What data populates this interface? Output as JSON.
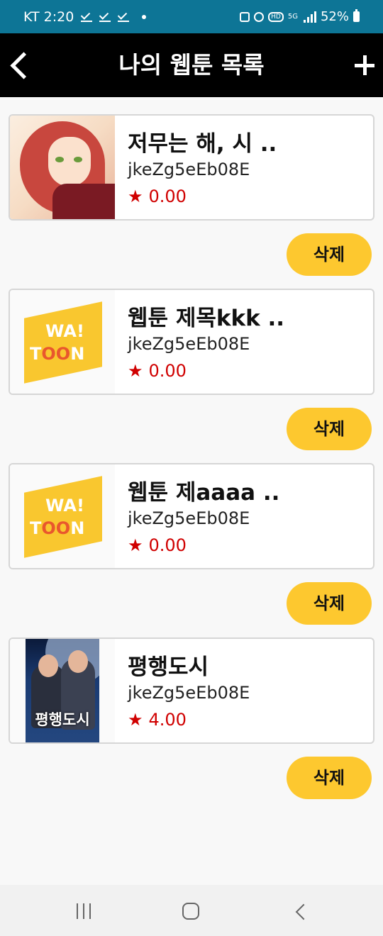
{
  "status_bar": {
    "carrier_time": "KT 2:20",
    "network": "5G",
    "hd": "HD",
    "battery": "52%"
  },
  "app_bar": {
    "title": "나의 웹툰 목록"
  },
  "webtoons": [
    {
      "title": "저무는 해, 시 ..",
      "author": "jkeZg5eEb08E",
      "rating": "0.00",
      "thumbnail": "illustration-red-hair"
    },
    {
      "title": "웹툰 제목kkk ..",
      "author": "jkeZg5eEb08E",
      "rating": "0.00",
      "thumbnail": "watoon-logo"
    },
    {
      "title": "웹툰 제aaaa ..",
      "author": "jkeZg5eEb08E",
      "rating": "0.00",
      "thumbnail": "watoon-logo"
    },
    {
      "title": "평행도시",
      "author": "jkeZg5eEb08E",
      "rating": "4.00",
      "thumbnail": "poster-parallel-city"
    }
  ],
  "delete_label": "삭제",
  "star_symbol": "★",
  "logo": {
    "line1": "WA!",
    "line2_a": "T",
    "line2_b": "OO",
    "line2_c": "N"
  },
  "poster_text": "평행도시",
  "colors": {
    "status_bar": "#0d7596",
    "app_bar": "#000000",
    "delete_button": "#fdc82f",
    "rating": "#d00000",
    "logo": "#f9c72f"
  }
}
